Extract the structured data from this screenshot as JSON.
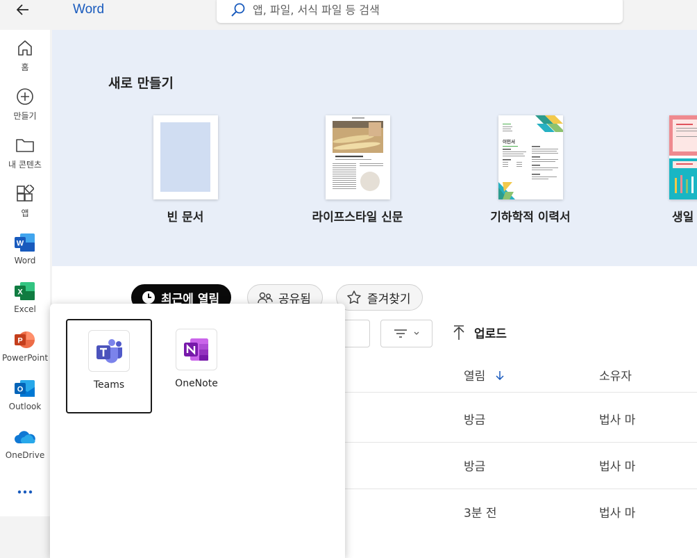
{
  "header": {
    "app_title": "Word",
    "search_placeholder": "앱, 파일, 서식 파일 등 검색"
  },
  "rail": {
    "items": [
      {
        "label": "홈",
        "icon": "home-icon"
      },
      {
        "label": "만들기",
        "icon": "plus-circle-icon"
      },
      {
        "label": "내 콘텐츠",
        "icon": "folder-icon"
      },
      {
        "label": "앱",
        "icon": "apps-icon"
      },
      {
        "label": "Word",
        "icon": "word-icon"
      },
      {
        "label": "Excel",
        "icon": "excel-icon"
      },
      {
        "label": "PowerPoint",
        "icon": "powerpoint-icon"
      },
      {
        "label": "Outlook",
        "icon": "outlook-icon"
      },
      {
        "label": "OneDrive",
        "icon": "onedrive-icon"
      }
    ],
    "more_icon": "more-icon"
  },
  "hero": {
    "title": "새로 만들기",
    "templates": [
      {
        "label": "빈 문서"
      },
      {
        "label": "라이프스타일 신문"
      },
      {
        "label": "기하학적 이력서"
      },
      {
        "label": "생일 상품권"
      }
    ],
    "resume_heading": "이민서"
  },
  "tabs": [
    {
      "label": "최근에 열림",
      "icon": "clock-icon",
      "active": true
    },
    {
      "label": "공유됨",
      "icon": "people-icon",
      "active": false
    },
    {
      "label": "즐겨찾기",
      "icon": "star-icon",
      "active": false
    }
  ],
  "toolbar": {
    "filter_icon": "filter-icon",
    "upload_label": "업로드"
  },
  "table": {
    "columns": [
      "열림",
      "소유자"
    ],
    "rows": [
      {
        "opened": "방금",
        "owner": "법사 마"
      },
      {
        "opened": "방금",
        "owner": "법사 마"
      },
      {
        "opened": "3분 전",
        "owner": "법사 마"
      }
    ]
  },
  "popup": {
    "apps": [
      {
        "name": "Teams",
        "icon": "teams-icon",
        "focused": true
      },
      {
        "name": "OneNote",
        "icon": "onenote-icon",
        "focused": false
      }
    ]
  },
  "colors": {
    "word_blue": "#185abd",
    "hero_bg": "#e8eef8",
    "teams_purple": "#5b5fc7",
    "onenote_purple": "#7719aa"
  }
}
